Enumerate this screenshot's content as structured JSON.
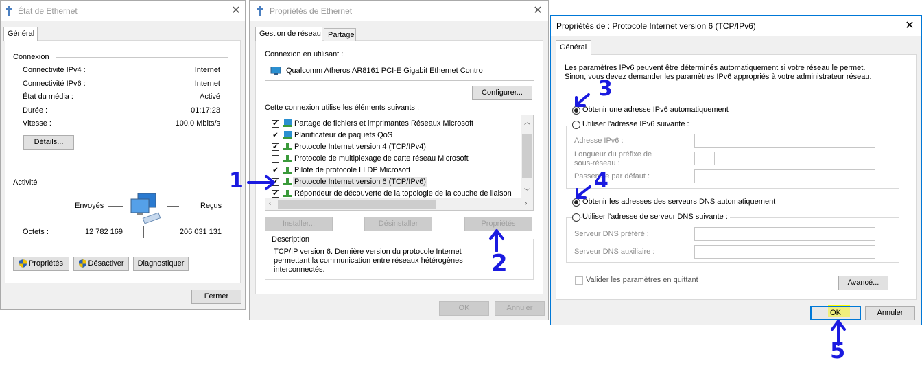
{
  "win1": {
    "title": "État de Ethernet",
    "tab": "Général",
    "connexion_header": "Connexion",
    "rows": [
      {
        "label": "Connectivité IPv4 :",
        "value": "Internet"
      },
      {
        "label": "Connectivité IPv6 :",
        "value": "Internet"
      },
      {
        "label": "État du média :",
        "value": "Activé"
      },
      {
        "label": "Durée :",
        "value": "01:17:23"
      },
      {
        "label": "Vitesse :",
        "value": "100,0 Mbits/s"
      }
    ],
    "details_btn": "Détails...",
    "activite_header": "Activité",
    "sent_label": "Envoyés",
    "recv_label": "Reçus",
    "octets_label": "Octets :",
    "sent_value": "12 782 169",
    "recv_value": "206 031 131",
    "btn_props": "Propriétés",
    "btn_disable": "Désactiver",
    "btn_diag": "Diagnostiquer",
    "btn_close": "Fermer"
  },
  "win2": {
    "title": "Propriétés de Ethernet",
    "tab_network": "Gestion de réseau",
    "tab_share": "Partage",
    "connect_using": "Connexion en utilisant :",
    "adapter": "Qualcomm Atheros AR8161 PCI-E Gigabit Ethernet Contro",
    "configure_btn": "Configurer...",
    "elements_label": "Cette connexion utilise les éléments suivants :",
    "items": [
      {
        "label": "Partage de fichiers et imprimantes Réseaux Microsoft",
        "checked": "✔"
      },
      {
        "label": "Planificateur de paquets QoS",
        "checked": "✔"
      },
      {
        "label": "Protocole Internet version 4 (TCP/IPv4)",
        "checked": "✔"
      },
      {
        "label": "Protocole de multiplexage de carte réseau Microsoft",
        "checked": ""
      },
      {
        "label": "Pilote de protocole LLDP Microsoft",
        "checked": "✔"
      },
      {
        "label": "Protocole Internet version 6 (TCP/IPv6)",
        "checked": "✔"
      },
      {
        "label": "Répondeur de découverte de la topologie de la couche de liaison",
        "checked": "✔"
      }
    ],
    "install_btn": "Installer...",
    "uninstall_btn": "Désinstaller",
    "props_btn": "Propriétés",
    "desc_title": "Description",
    "desc_text": "TCP/IP version 6. Dernière version du protocole Internet permettant la communication entre réseaux hétérogènes interconnectés.",
    "ok": "OK",
    "cancel": "Annuler"
  },
  "win3": {
    "title": "Propriétés de : Protocole Internet version 6 (TCP/IPv6)",
    "tab": "Général",
    "intro": "Les paramètres IPv6 peuvent être déterminés automatiquement si votre réseau le permet. Sinon, vous devez demander les paramètres IPv6 appropriés à votre administrateur réseau.",
    "radio_auto_ip": "Obtenir une adresse IPv6 automatiquement",
    "radio_manual_ip": "Utiliser l'adresse IPv6 suivante :",
    "ipv6_addr": "Adresse IPv6 :",
    "prefix_len_1": "Longueur du préfixe de",
    "prefix_len_2": "sous-réseau :",
    "gateway": "Passerelle par défaut :",
    "radio_auto_dns": "Obtenir les adresses des serveurs DNS automatiquement",
    "radio_manual_dns": "Utiliser l'adresse de serveur DNS suivante :",
    "dns_pref": "Serveur DNS préféré :",
    "dns_aux": "Serveur DNS auxiliaire :",
    "validate": "Valider les paramètres en quittant",
    "advanced": "Avancé...",
    "ok": "OK",
    "cancel": "Annuler"
  },
  "annotations": {
    "n1": "1",
    "n2": "2",
    "n3": "3",
    "n4": "4",
    "n5": "5"
  },
  "colors": {
    "annotation": "#1a1ae0",
    "highlight": "#ffff00",
    "accent": "#0078d7"
  }
}
